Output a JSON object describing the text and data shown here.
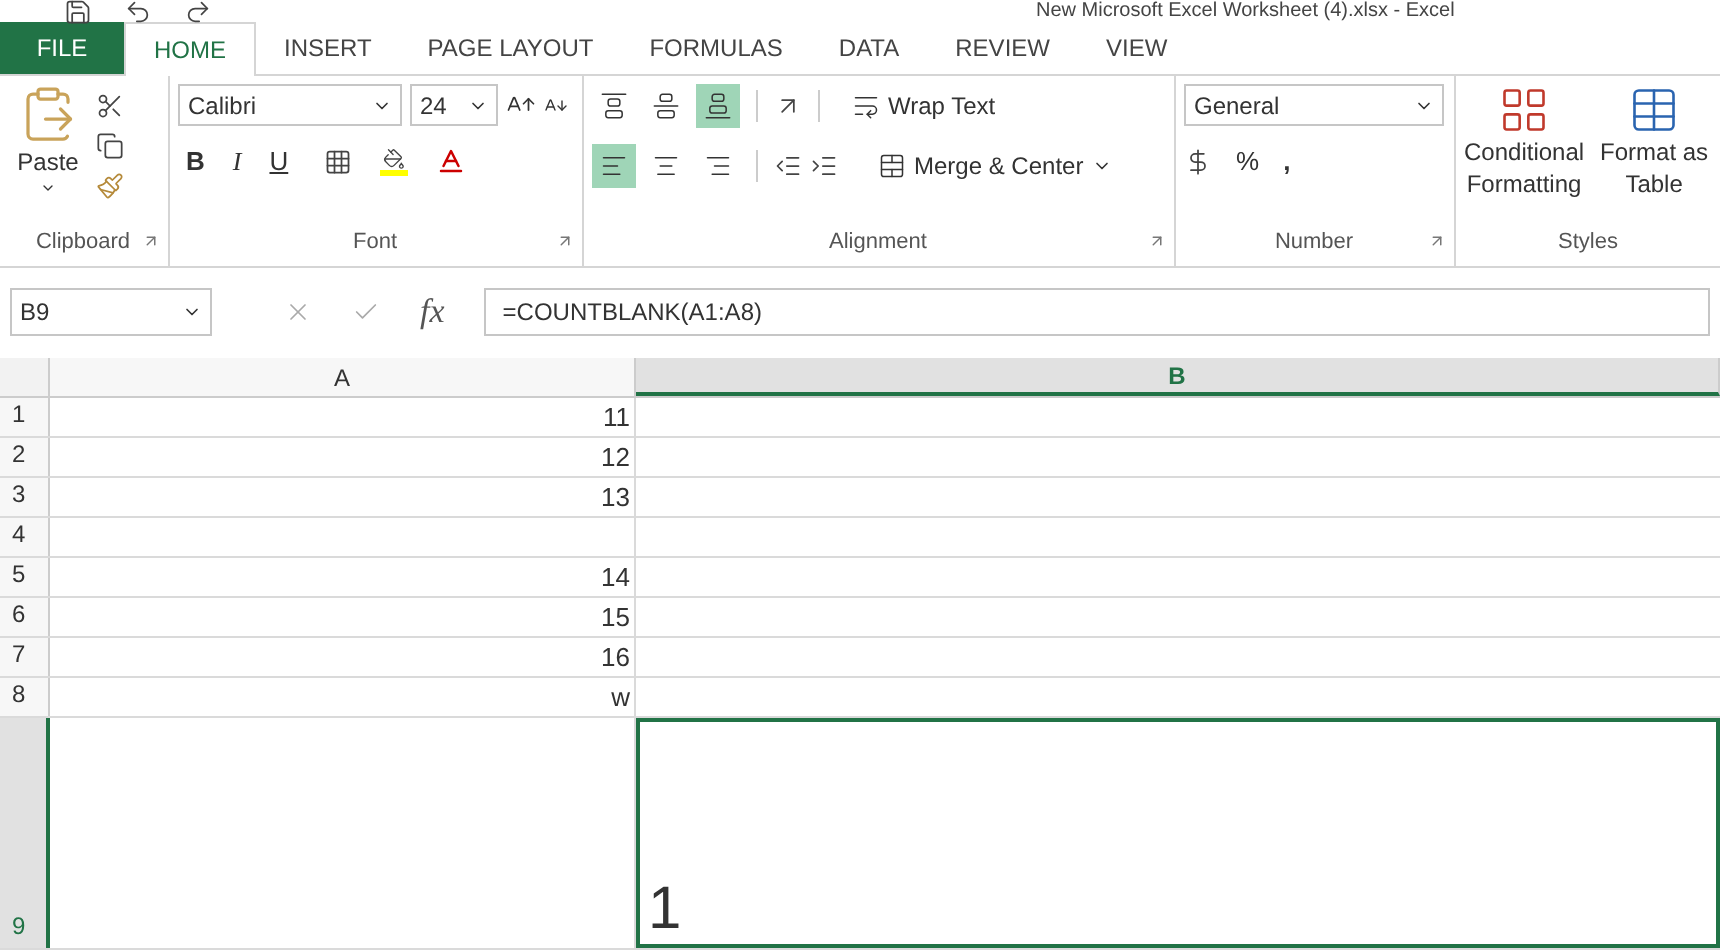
{
  "window": {
    "title": "New Microsoft Excel Worksheet (4).xlsx - Excel"
  },
  "tabs": [
    {
      "label": "FILE",
      "kind": "file",
      "selected": false
    },
    {
      "label": "HOME",
      "kind": "tab",
      "selected": true
    },
    {
      "label": "INSERT",
      "kind": "tab",
      "selected": false
    },
    {
      "label": "PAGE LAYOUT",
      "kind": "tab",
      "selected": false
    },
    {
      "label": "FORMULAS",
      "kind": "tab",
      "selected": false
    },
    {
      "label": "DATA",
      "kind": "tab",
      "selected": false
    },
    {
      "label": "REVIEW",
      "kind": "tab",
      "selected": false
    },
    {
      "label": "VIEW",
      "kind": "tab",
      "selected": false
    }
  ],
  "clipboard": {
    "paste": "Paste",
    "label": "Clipboard"
  },
  "font": {
    "name": "Calibri",
    "size": "24",
    "label": "Font",
    "bold": "B",
    "italic": "I",
    "underline": "U"
  },
  "alignment": {
    "label": "Alignment",
    "wrap_text": "Wrap Text",
    "merge_center": "Merge & Center",
    "vertical": [
      {
        "selected": false
      },
      {
        "selected": false
      },
      {
        "selected": true
      }
    ],
    "horizontal": [
      {
        "selected": true
      },
      {
        "selected": false
      },
      {
        "selected": false
      }
    ]
  },
  "number": {
    "format": "General",
    "label": "Number",
    "percent": "%",
    "comma": ","
  },
  "styles": {
    "label": "Styles",
    "conditional": [
      "Conditional",
      "Formatting"
    ],
    "format_table": [
      "Format as",
      "Table"
    ]
  },
  "formula_bar": {
    "name_box": "B9",
    "fx": "fx",
    "formula": "=COUNTBLANK(A1:A8)"
  },
  "columns": [
    {
      "label": "A",
      "selected": false
    },
    {
      "label": "B",
      "selected": true
    }
  ],
  "rows": [
    {
      "header": "1",
      "a": "11",
      "selected": false
    },
    {
      "header": "2",
      "a": "12",
      "selected": false
    },
    {
      "header": "3",
      "a": "13",
      "selected": false
    },
    {
      "header": "4",
      "selected": false
    },
    {
      "header": "5",
      "a": "14",
      "selected": false
    },
    {
      "header": "6",
      "a": "15",
      "selected": false
    },
    {
      "header": "7",
      "a": "16",
      "selected": false
    },
    {
      "header": "8",
      "a": "w",
      "selected": false
    },
    {
      "header": "9",
      "b": "1",
      "selected": true
    }
  ]
}
